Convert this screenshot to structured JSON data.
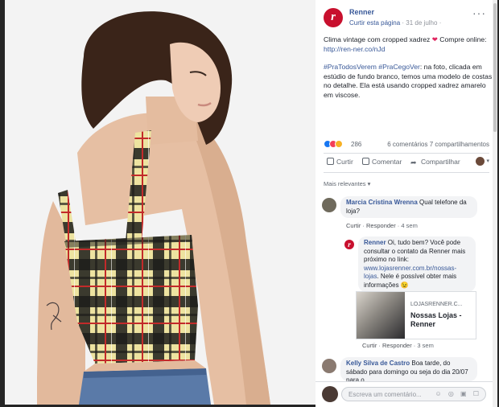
{
  "post": {
    "page_name": "Renner",
    "like_page": "Curtir esta página",
    "date_sep": "·",
    "date": "31 de julho",
    "globe": "·",
    "paragraph1": "Clima vintage com cropped xadrez ",
    "heart": "❤",
    "paragraph1b": " Compre online: ",
    "link1": "http://ren-ner.co/nJd",
    "paragraph2_tags": "#PraTodosVerem #PraCegoVer",
    "paragraph2": ": na foto, clicada em estúdio de fundo branco, temos uma modelo de costas no detalhe. Ela está usando cropped xadrez amarelo em viscose."
  },
  "reactions": {
    "count": "286",
    "comments": "6 comentários",
    "shares": "7 compartilhamentos"
  },
  "actions": {
    "like": "Curtir",
    "comment": "Comentar",
    "share": "Compartilhar"
  },
  "comments_filter": "Mais relevantes ▾",
  "comments": [
    {
      "author": "Marcia Cristina Wrenna",
      "text": "Qual telefone da loja?",
      "like": "Curtir",
      "reply": "Responder",
      "time": "4 sem"
    },
    {
      "author": "Renner",
      "text_a": "Oi, tudo bem? Você pode consultar o contato da Renner mais próximo no link: ",
      "link": "www.lojasrenner.com.br/nossas-lojas",
      "text_b": ". Nele é possível obter mais informações ",
      "emoji": "😉",
      "like": "Curtir",
      "reply": "Responder",
      "time": "3 sem"
    },
    {
      "author": "Kelly Silva de Castro",
      "text": "Boa tarde, do sábado para domingo ou seja do dia 20/07 para o",
      "like": "",
      "reply": "",
      "time": ""
    }
  ],
  "link_card": {
    "domain": "LOJASRENNER.C...",
    "title": "Nossas Lojas - Renner"
  },
  "composer": {
    "placeholder": "Escreva um comentário...",
    "icons": "☺ ◎ ▣ ☐"
  },
  "header_more": "···"
}
